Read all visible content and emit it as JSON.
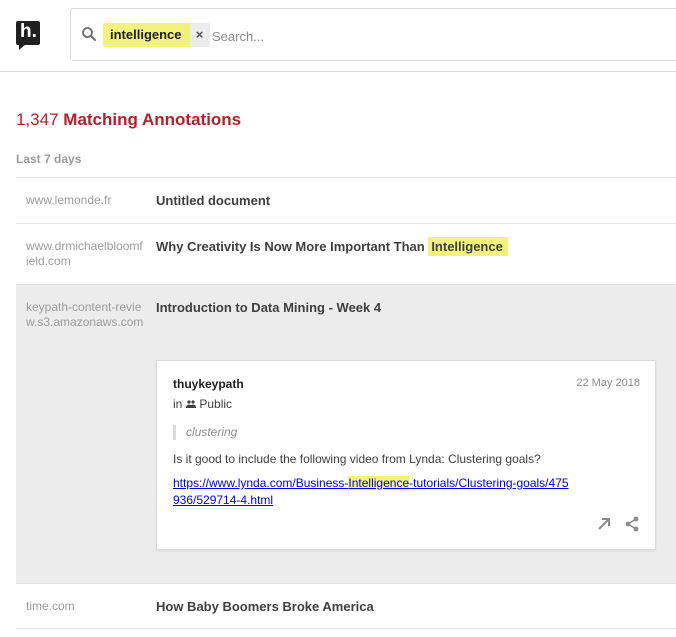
{
  "search": {
    "query_tag": "intelligence",
    "remove_symbol": "×",
    "placeholder": "Search..."
  },
  "summary": {
    "count": "1,347",
    "label": "Matching Annotations"
  },
  "period_heading": "Last 7 days",
  "rows": [
    {
      "domain": "www.lemonde.fr",
      "title": "Untitled document"
    },
    {
      "domain": "www.drmichaelbloomfield.com",
      "title": "Why Creativity Is Now More Important Than ",
      "title_highlight": "Intelligence"
    },
    {
      "domain": "keypath-content-review.s3.amazonaws.com",
      "title": "Introduction to Data Mining - Week 4"
    },
    {
      "domain": "time.com",
      "title": "How Baby Boomers Broke America"
    }
  ],
  "annotation": {
    "user": "thuykeypath",
    "date": "22 May 2018",
    "group_prefix": "in",
    "group": "Public",
    "quote": "clustering",
    "text": "Is it good to include the following video from Lynda: Clustering goals?",
    "link_before": "https://www.lynda.com/Business-",
    "link_highlight": "Intelligence",
    "link_after": "-tutorials/Clustering-goals/475936/529714-4.html"
  },
  "icons": {
    "logo": "hypothesis-logo-icon",
    "search": "search-icon",
    "group": "group-icon",
    "reply": "reply-icon",
    "share": "share-icon"
  },
  "colors": {
    "highlight": "#f3f37b",
    "brand": "#bd1c2b",
    "expanded_row": "#ececec"
  }
}
